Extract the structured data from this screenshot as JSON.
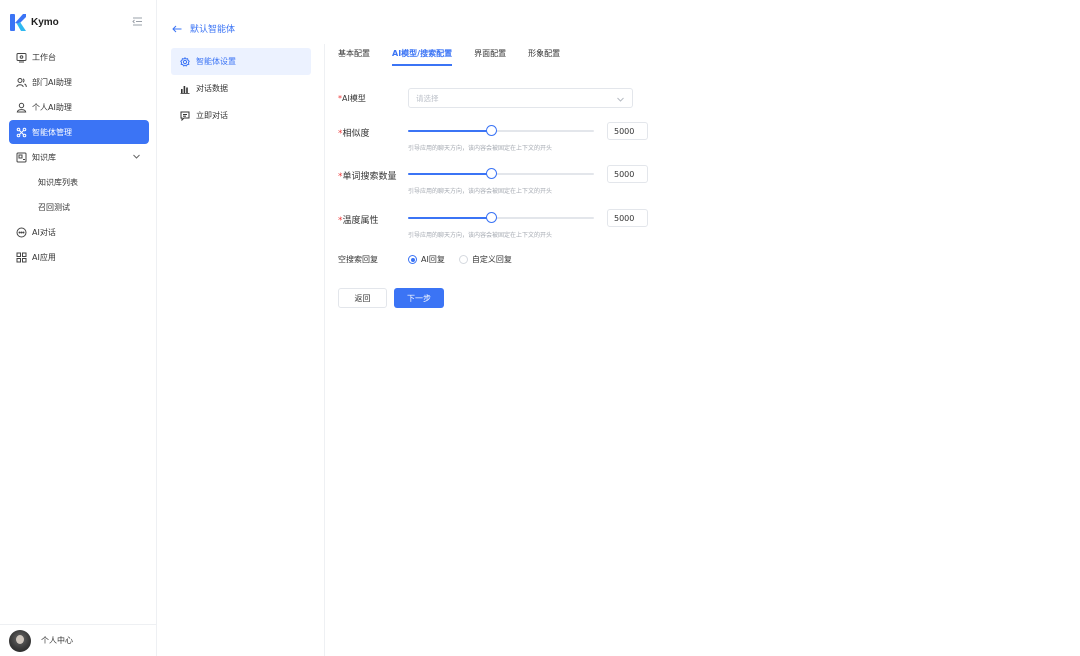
{
  "app": {
    "name": "Kymo",
    "brand_color": "#3b74f5"
  },
  "sidebar": {
    "items": [
      {
        "label": "工作台",
        "icon": "dashboard-icon"
      },
      {
        "label": "部门AI助理",
        "icon": "team-icon"
      },
      {
        "label": "个人AI助理",
        "icon": "user-icon"
      },
      {
        "label": "智能体管理",
        "icon": "agent-icon",
        "active": true
      },
      {
        "label": "知识库",
        "icon": "knowledge-icon",
        "expanded": true
      },
      {
        "label": "知识库列表",
        "sub": true
      },
      {
        "label": "召回测试",
        "sub": true
      },
      {
        "label": "AI对话",
        "icon": "chat-icon"
      },
      {
        "label": "AI应用",
        "icon": "apps-icon"
      }
    ],
    "user": {
      "label": "个人中心"
    }
  },
  "breadcrumb": {
    "back_label": "默认智能体"
  },
  "submenu": {
    "items": [
      {
        "label": "智能体设置",
        "active": true
      },
      {
        "label": "对话数据"
      },
      {
        "label": "立即对话"
      }
    ]
  },
  "tabs": [
    {
      "label": "基本配置"
    },
    {
      "label": "AI模型/搜索配置",
      "active": true
    },
    {
      "label": "界面配置"
    },
    {
      "label": "形象配置"
    }
  ],
  "form": {
    "model": {
      "label": "AI模型",
      "placeholder": "请选择"
    },
    "similarity": {
      "label": "相似度",
      "value": "5000",
      "level": 0.45,
      "hint": "引导应用的聊天方向，该内容会被固定在上下文的开头"
    },
    "search_count": {
      "label": "单词搜索数量",
      "value": "5000",
      "level": 0.45,
      "hint": "引导应用的聊天方向，该内容会被固定在上下文的开头"
    },
    "temperature": {
      "label": "温度属性",
      "value": "5000",
      "level": 0.45,
      "hint": "引导应用的聊天方向，该内容会被固定在上下文的开头"
    },
    "empty_reply": {
      "label": "空搜索回复",
      "options": [
        "AI回复",
        "自定义回复"
      ],
      "selected": "AI回复"
    },
    "back_button": "返回",
    "next_button": "下一步"
  }
}
